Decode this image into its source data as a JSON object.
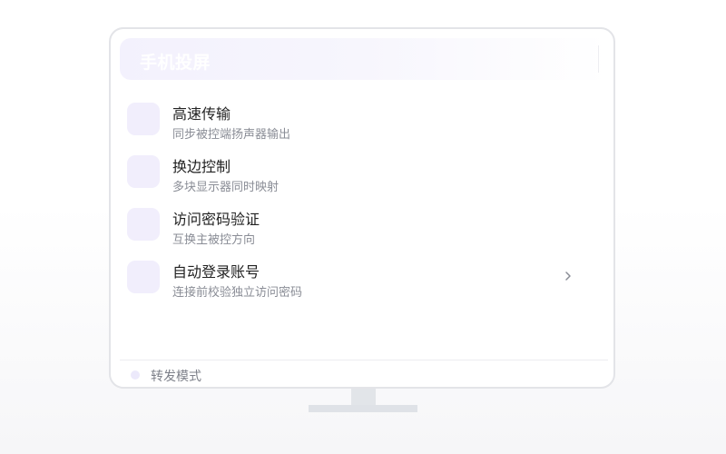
{
  "header": {
    "title": "手机投屏"
  },
  "items": [
    {
      "title": "高速传输",
      "subtitle": "同步被控端扬声器输出",
      "icon": "feature-icon",
      "has_chevron": false
    },
    {
      "title": "换边控制",
      "subtitle": "多块显示器同时映射",
      "icon": "feature-icon",
      "has_chevron": false
    },
    {
      "title": "访问密码验证",
      "subtitle": "互换主被控方向",
      "icon": "feature-icon",
      "has_chevron": false
    },
    {
      "title": "自动登录账号",
      "subtitle": "连接前校验独立访问密码",
      "icon": "feature-icon",
      "has_chevron": true
    }
  ],
  "footer": {
    "label": "转发模式"
  },
  "colors": {
    "accent_light": "#f1eefc",
    "text_primary": "#222222",
    "text_secondary": "#8a8d96"
  }
}
